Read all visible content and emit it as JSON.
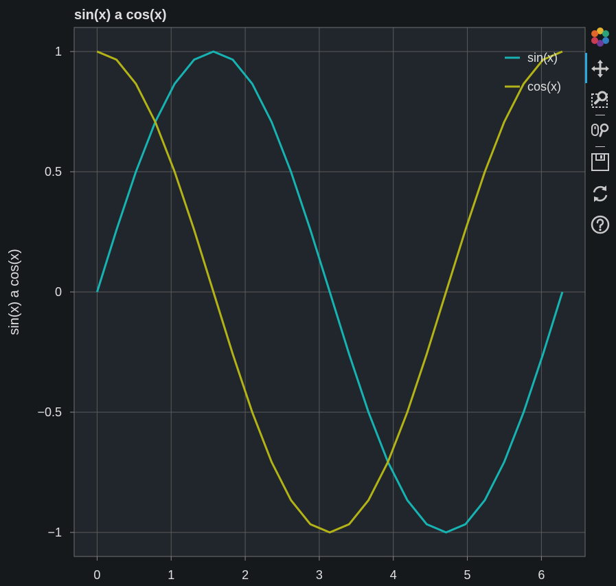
{
  "chart_data": {
    "type": "line",
    "title": "sin(x) a cos(x)",
    "xlabel": "",
    "ylabel": "sin(x) a cos(x)",
    "xlim": [
      -0.31,
      6.59
    ],
    "ylim": [
      -1.1,
      1.1
    ],
    "xticks": [
      0,
      1,
      2,
      3,
      4,
      5,
      6
    ],
    "yticks": [
      1,
      0.5,
      0,
      -0.5,
      -1
    ],
    "xtick_labels": [
      "0",
      "1",
      "2",
      "3",
      "4",
      "5",
      "6"
    ],
    "ytick_labels": [
      "1",
      "0.5",
      "0",
      "−0.5",
      "−1"
    ],
    "grid": true,
    "legend_position": "top-right",
    "x": [
      0,
      0.2618,
      0.5236,
      0.7854,
      1.0472,
      1.309,
      1.5708,
      1.8326,
      2.0944,
      2.3562,
      2.618,
      2.8798,
      3.1416,
      3.4034,
      3.6652,
      3.927,
      4.1888,
      4.4506,
      4.7124,
      4.9742,
      5.236,
      5.4978,
      5.7596,
      6.0214,
      6.2832
    ],
    "series": [
      {
        "name": "sin(x)",
        "color": "#17b3b3",
        "values": [
          0,
          0.2588,
          0.5,
          0.7071,
          0.866,
          0.9659,
          1,
          0.9659,
          0.866,
          0.7071,
          0.5,
          0.2588,
          0,
          -0.2588,
          -0.5,
          -0.7071,
          -0.866,
          -0.9659,
          -1,
          -0.9659,
          -0.866,
          -0.7071,
          -0.5,
          -0.2588,
          0
        ]
      },
      {
        "name": "cos(x)",
        "color": "#b3b317",
        "values": [
          1,
          0.9659,
          0.866,
          0.7071,
          0.5,
          0.2588,
          0,
          -0.2588,
          -0.5,
          -0.7071,
          -0.866,
          -0.9659,
          -1,
          -0.9659,
          -0.866,
          -0.7071,
          -0.5,
          -0.2588,
          0,
          0.2588,
          0.5,
          0.7071,
          0.866,
          0.9659,
          1
        ]
      }
    ]
  },
  "toolbar": {
    "tools": [
      {
        "name": "bokeh-logo-icon",
        "interactable": true
      },
      {
        "name": "pan-icon",
        "interactable": true,
        "active": true
      },
      {
        "name": "box-zoom-icon",
        "interactable": true
      },
      {
        "name": "wheel-zoom-icon",
        "interactable": true
      },
      {
        "name": "save-icon",
        "interactable": true
      },
      {
        "name": "reset-icon",
        "interactable": true
      },
      {
        "name": "help-icon",
        "interactable": true
      }
    ]
  },
  "colors": {
    "page_background": "#15191c",
    "plot_background": "#20262b",
    "grid": "#5b5b5b",
    "text": "#e0e0e0",
    "toolbar_active": "#26aae1"
  }
}
